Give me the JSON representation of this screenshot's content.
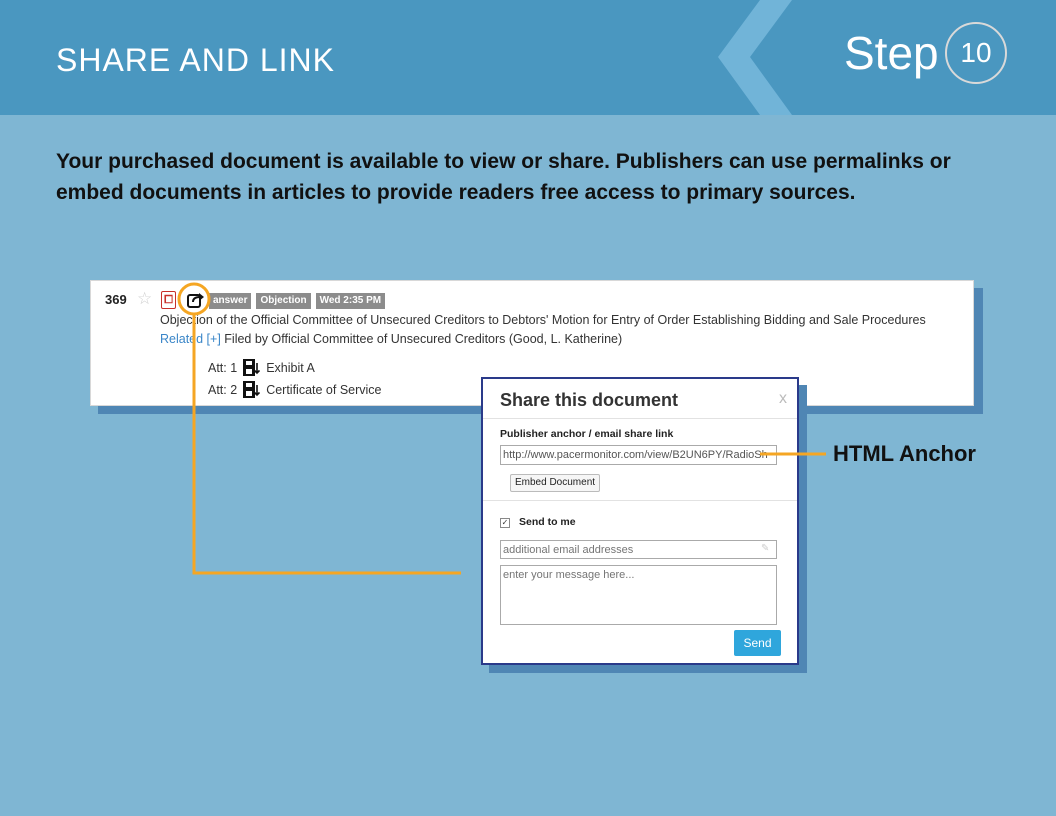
{
  "header": {
    "title": "SHARE AND LINK",
    "step_label": "Step",
    "step_number": "10",
    "bg_color": "#4a97c0"
  },
  "intro_text": "Your purchased document is available to view or share.  Publishers can use permalinks or embed documents in articles to provide readers free access to primary sources.",
  "docket": {
    "entry_number": "369",
    "icons": [
      "star-icon",
      "pdf-icon",
      "share-icon"
    ],
    "tags": [
      "answer",
      "Objection",
      "Wed 2:35 PM"
    ],
    "title": "Objection of the Official Committee of Unsecured Creditors to Debtors' Motion for Entry of Order Establishing Bidding and Sale Procedures",
    "related_link": "Related [+]",
    "filed_by": " Filed by Official Committee of Unsecured Creditors (Good, L. Katherine)",
    "attachments": [
      {
        "label": "Att: 1",
        "name": "Exhibit A"
      },
      {
        "label": "Att: 2",
        "name": "Certificate of Service"
      }
    ]
  },
  "callout": {
    "label": "HTML Anchor",
    "color": "#f5a623"
  },
  "modal": {
    "title": "Share this document",
    "close_glyph": "x",
    "anchor_label": "Publisher anchor / email share link",
    "anchor_value": "http://www.pacermonitor.com/view/B2UN6PY/RadioSh",
    "embed_label": "Embed Document",
    "send_to_me_label": "Send to me",
    "send_to_me_checked": true,
    "email_placeholder": "additional email addresses",
    "message_placeholder": "enter your message here...",
    "send_label": "Send",
    "accent_color": "#2fa6dc"
  }
}
